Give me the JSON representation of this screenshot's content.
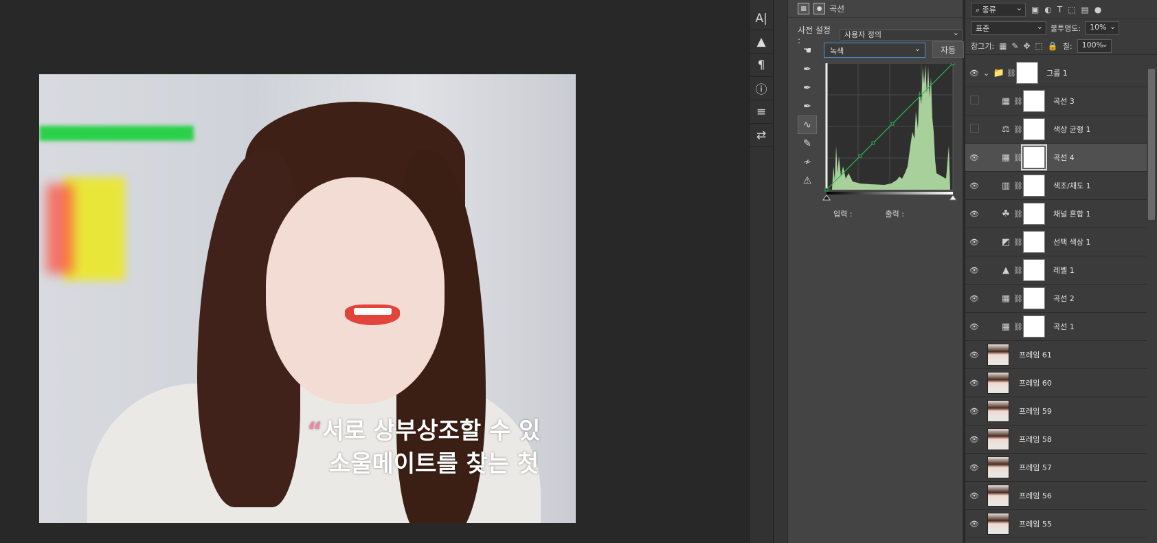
{
  "canvas": {
    "caption_quote": "“",
    "caption_line1": "서로 상부상조할 수 있",
    "caption_line2": "소울메이트를 찾는 첫"
  },
  "toolbar": {
    "items": [
      {
        "icon": "character-panel-icon",
        "glyph": "A|"
      },
      {
        "icon": "glyph-panel-icon",
        "glyph": "▲"
      },
      {
        "icon": "paragraph-panel-icon",
        "glyph": "¶"
      },
      {
        "icon": "info-panel-icon",
        "glyph": "ⓘ"
      },
      {
        "icon": "brush-settings-icon",
        "glyph": "≡"
      },
      {
        "icon": "adjust-sliders-icon",
        "glyph": "⇄"
      }
    ]
  },
  "properties": {
    "title": "곡선",
    "preset_label": "사전 설정 :",
    "preset_value": "사용자 정의",
    "channel": "녹색",
    "auto_label": "자동",
    "input_label": "입력 :",
    "output_label": "출력 :",
    "curve_color": "#29b84a",
    "histogram_color": "#a8d09a"
  },
  "layers": {
    "filter": "종류",
    "blend_mode": "표준",
    "opacity_label": "불투명도:",
    "opacity": "10%",
    "lock_label": "잠그기:",
    "fill_label": "칠:",
    "fill": "100%",
    "items": [
      {
        "name": "그룹 1",
        "type": "group",
        "visible": true
      },
      {
        "name": "곡선 3",
        "type": "curves",
        "visible": false
      },
      {
        "name": "색상 균형 1",
        "type": "color-balance",
        "visible": false
      },
      {
        "name": "곡선 4",
        "type": "curves",
        "visible": true,
        "selected": true
      },
      {
        "name": "색조/채도 1",
        "type": "hue-sat",
        "visible": true
      },
      {
        "name": "채널 혼합 1",
        "type": "channel-mixer",
        "visible": true
      },
      {
        "name": "선택 색상 1",
        "type": "selective-color",
        "visible": true
      },
      {
        "name": "레벨 1",
        "type": "levels",
        "visible": true
      },
      {
        "name": "곡선 2",
        "type": "curves",
        "visible": true
      },
      {
        "name": "곡선 1",
        "type": "curves",
        "visible": true
      },
      {
        "name": "프레임 61",
        "type": "frame",
        "visible": true
      },
      {
        "name": "프레임 60",
        "type": "frame",
        "visible": true
      },
      {
        "name": "프레임 59",
        "type": "frame",
        "visible": true
      },
      {
        "name": "프레임 58",
        "type": "frame",
        "visible": true
      },
      {
        "name": "프레임 57",
        "type": "frame",
        "visible": true
      },
      {
        "name": "프레임 56",
        "type": "frame",
        "visible": true
      },
      {
        "name": "프레임 55",
        "type": "frame",
        "visible": true
      }
    ]
  }
}
